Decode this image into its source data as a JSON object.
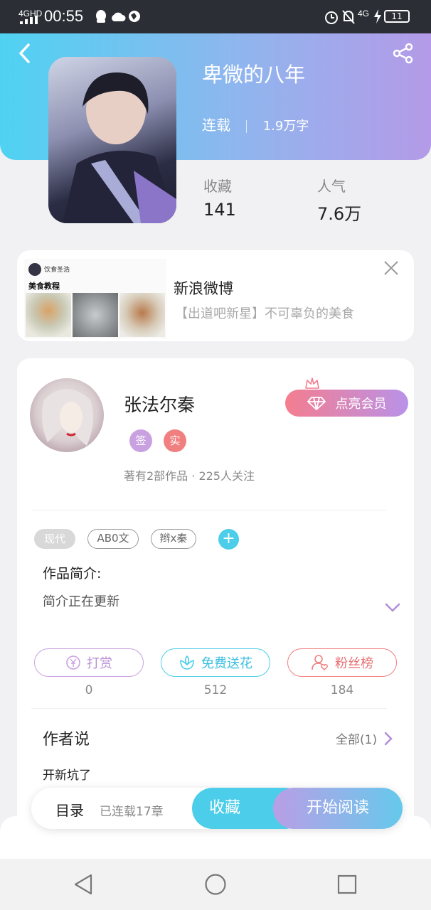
{
  "status_bar": {
    "network": "4GHD",
    "time": "00:55",
    "signal2": "4G",
    "battery": "11"
  },
  "book": {
    "title": "卑微的八年",
    "status": "连载",
    "word_count": "1.9万字",
    "collect_label": "收藏",
    "collect_value": "141",
    "popularity_label": "人气",
    "popularity_value": "7.6万"
  },
  "ad": {
    "thumb_author": "饮食圣浩",
    "thumb_title": "美食教程",
    "source": "新浪微博",
    "text": "【出道吧新星】不可辜负的美食"
  },
  "author": {
    "name": "张法尔秦",
    "badge_sign": "签",
    "badge_real": "实",
    "vip_button": "点亮会员",
    "summary": "著有2部作品 · 225人关注"
  },
  "tags": [
    "现代",
    "AB0文",
    "辫x秦"
  ],
  "intro": {
    "heading": "作品简介:",
    "text": "简介正在更新"
  },
  "actions": {
    "reward_label": "打赏",
    "reward_count": "0",
    "flower_label": "免费送花",
    "flower_count": "512",
    "fans_label": "粉丝榜",
    "fans_count": "184"
  },
  "author_says": {
    "heading": "作者说",
    "all_label": "全部(1)",
    "content": "开新坑了"
  },
  "bottom_bar": {
    "catalog_label": "目录",
    "chapters": "已连载17章",
    "collect_button": "收藏",
    "read_button": "开始阅读"
  },
  "colors": {
    "hero_start": "#4fd2f2",
    "hero_end": "#b49ae8",
    "vip_start": "#f47d8f",
    "vip_end": "#b992e8",
    "cyan": "#4ccde9",
    "purple": "#c9a1e0",
    "red": "#f07f7f"
  }
}
